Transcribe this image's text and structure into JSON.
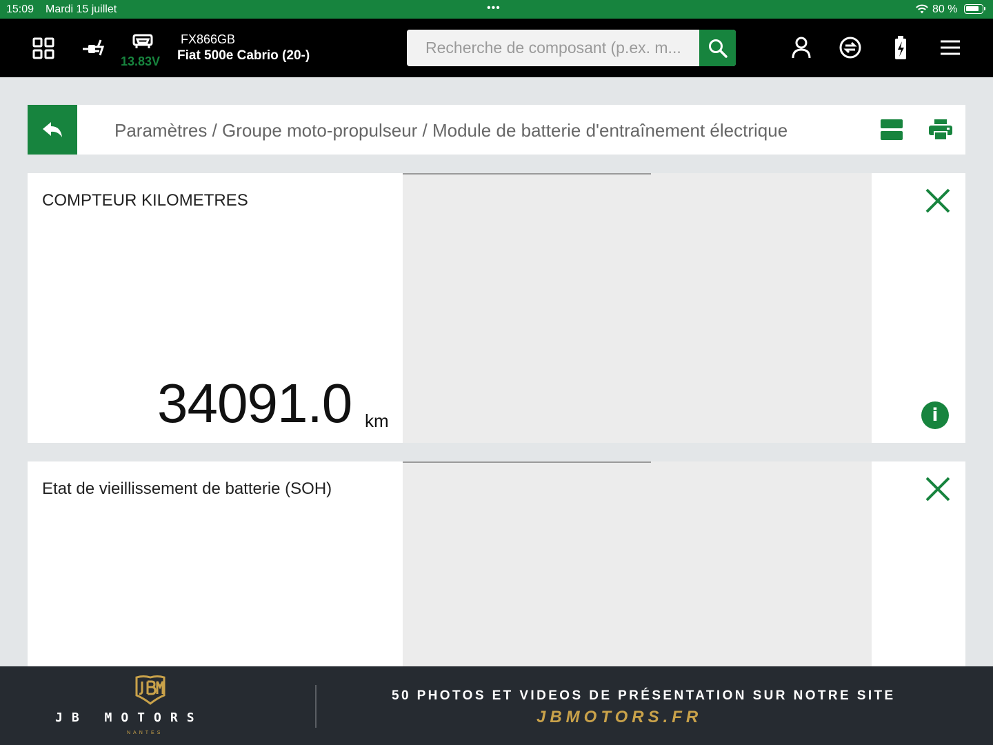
{
  "status_bar": {
    "time": "15:09",
    "date": "Mardi 15 juillet",
    "battery": "80 %"
  },
  "top_bar": {
    "voltage": "13.83V",
    "plate": "FX866GB",
    "model": "Fiat 500e Cabrio (20-)",
    "search_placeholder": "Recherche de composant (p.ex. m...",
    "icons": [
      "grid-icon",
      "plug-icon",
      "car-icon",
      "search-icon",
      "user-icon",
      "sync-icon",
      "battery-icon",
      "menu-icon"
    ]
  },
  "breadcrumb": {
    "path": "Paramètres / Groupe moto-propulseur / Module de batterie d'entraînement électrique"
  },
  "cards": [
    {
      "title": "COMPTEUR KILOMETRES",
      "value": "34091.0",
      "unit": "km"
    },
    {
      "title": "Etat de vieillissement de batterie (SOH)"
    }
  ],
  "footer": {
    "brand": "JB MOTORS",
    "city": "NANTES",
    "promo": "50 PHOTOS ET VIDEOS DE PRÉSENTATION SUR NOTRE SITE",
    "site": "JBMOTORS.FR"
  },
  "colors": {
    "accent": "#17843e",
    "topbar": "#000000",
    "background": "#e3e6e8",
    "footer": "#262b31",
    "gold": "#c9a24a"
  }
}
